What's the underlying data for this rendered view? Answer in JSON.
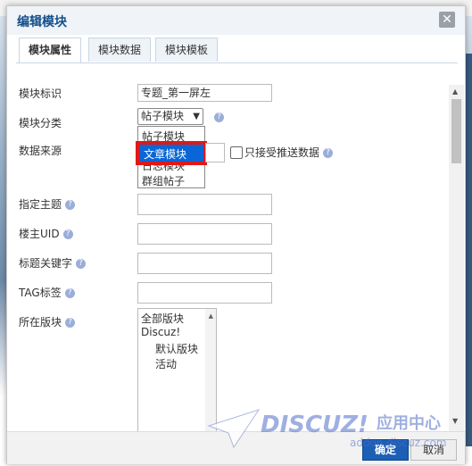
{
  "dialog": {
    "title": "编辑模块",
    "close_symbol": "✕"
  },
  "tabs": [
    {
      "label": "模块属性",
      "active": true
    },
    {
      "label": "模块数据",
      "active": false
    },
    {
      "label": "模块模板",
      "active": false
    }
  ],
  "form": {
    "module_id": {
      "label": "模块标识",
      "value": "专题_第一屏左"
    },
    "module_category": {
      "label": "模块分类",
      "selected": "帖子模块",
      "options": [
        "帖子模块",
        "文章模块",
        "日志模块",
        "群组帖子"
      ],
      "highlighted": "文章模块"
    },
    "data_source": {
      "label": "数据来源",
      "checkbox_label": "只接受推送数据"
    },
    "topic": {
      "label": "指定主题",
      "value": ""
    },
    "owner_uid": {
      "label": "楼主UID",
      "value": ""
    },
    "title_keyword": {
      "label": "标题关键字",
      "value": ""
    },
    "tag": {
      "label": "TAG标签",
      "value": ""
    },
    "forum": {
      "label": "所在版块",
      "items": [
        "全部版块",
        "Discuz!",
        "默认版块",
        "活动"
      ]
    }
  },
  "footer": {
    "ok_label": "确定",
    "cancel_label": "取消"
  },
  "watermark": {
    "brand": "DISCUZ!",
    "cn": "应用中心",
    "url": "addon.discuz.com"
  },
  "colors": {
    "accent": "#1c5fb5",
    "highlight": "#0a66d6",
    "red_box": "#e01818"
  }
}
